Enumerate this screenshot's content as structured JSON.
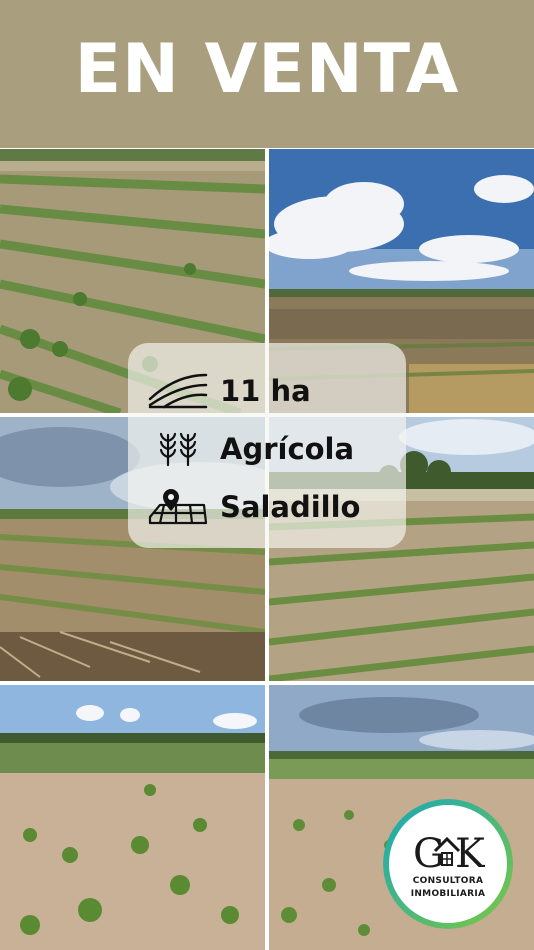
{
  "banner": {
    "title": "EN VENTA",
    "background": "#a99f7f"
  },
  "photos": [
    {
      "name": "field-photo-1"
    },
    {
      "name": "field-photo-2"
    },
    {
      "name": "field-photo-3"
    },
    {
      "name": "field-photo-4"
    },
    {
      "name": "field-photo-5"
    },
    {
      "name": "field-photo-6"
    }
  ],
  "info": {
    "area": {
      "icon": "field-rows-icon",
      "text": "11 ha"
    },
    "use": {
      "icon": "wheat-icon",
      "text": "Agrícola"
    },
    "location": {
      "icon": "map-pin-icon",
      "text": "Saladillo"
    }
  },
  "logo": {
    "mark": "GK",
    "line1": "CONSULTORA",
    "line2": "INMOBILIARIA",
    "ring_colors": [
      "#18a8b8",
      "#7cc742"
    ]
  }
}
